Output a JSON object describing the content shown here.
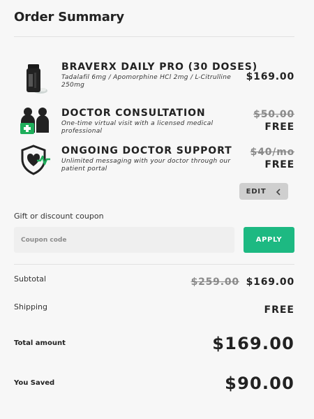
{
  "title": "Order Summary",
  "items": [
    {
      "name": "BRAVERX DAILY PRO (30 DOSES)",
      "description": "Tadalafil 6mg / Apomorphine HCl 2mg / L-Citrulline 250mg",
      "price": "$169.00",
      "icon": "pill-bottle-icon"
    },
    {
      "name": "DOCTOR CONSULTATION",
      "description": "One-time virtual visit with a licensed medical professional",
      "original_price": "$50.00",
      "price": "FREE",
      "icon": "doctor-consultation-icon"
    },
    {
      "name": "ONGOING DOCTOR SUPPORT",
      "description": "Unlimited messaging with your doctor through our patient portal",
      "original_price": "$40/mo",
      "price": "FREE",
      "icon": "shield-heart-icon"
    }
  ],
  "edit_label": "EDIT",
  "coupon": {
    "label": "Gift or discount coupon",
    "placeholder": "Coupon code",
    "value": "",
    "apply_label": "APPLY"
  },
  "totals": {
    "subtotal_label": "Subtotal",
    "subtotal_original": "$259.00",
    "subtotal": "$169.00",
    "shipping_label": "Shipping",
    "shipping": "FREE",
    "total_label": "Total amount",
    "total": "$169.00",
    "saved_label": "You Saved",
    "saved": "$90.00"
  },
  "colors": {
    "accent": "#1db982",
    "background": "#f7f7f7",
    "strike": "#8a8a8a",
    "icon_green": "#1fae5b"
  }
}
